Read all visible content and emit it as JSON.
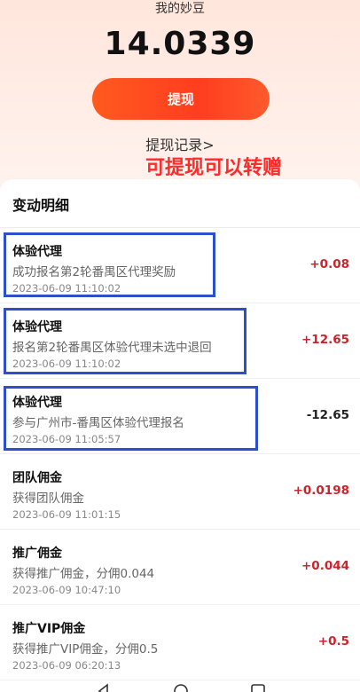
{
  "balance": {
    "label": "我的妙豆",
    "value": "14.0339"
  },
  "withdraw_button": "提现",
  "records_link": "提现记录>",
  "annotation": "可提现可以转赠",
  "details": {
    "title": "变动明细",
    "rows": [
      {
        "title": "体验代理",
        "desc": "成功报名第2轮番禺区代理奖励",
        "time": "2023-06-09 11:10:02",
        "amount": "+0.08"
      },
      {
        "title": "体验代理",
        "desc": "报名第2轮番禺区体验代理未选中退回",
        "time": "2023-06-09 11:10:02",
        "amount": "+12.65"
      },
      {
        "title": "体验代理",
        "desc": "参与广州市-番禺区体验代理报名",
        "time": "2023-06-09 11:05:57",
        "amount": "-12.65"
      },
      {
        "title": "团队佣金",
        "desc": "获得团队佣金",
        "time": "2023-06-09 11:01:15",
        "amount": "+0.0198"
      },
      {
        "title": "推广佣金",
        "desc": "获得推广佣金，分佣0.044",
        "time": "2023-06-09 10:47:10",
        "amount": "+0.044"
      },
      {
        "title": "推广VIP佣金",
        "desc": "获得推广VIP佣金，分佣0.5",
        "time": "2023-06-09 06:20:13",
        "amount": "+0.5"
      }
    ]
  },
  "colors": {
    "accent": "#ff4a1f",
    "positive": "#c9252d",
    "annotation": "#ff2a2a",
    "highlight_box": "#2d4fcc"
  },
  "navbar_icons": [
    "back-icon",
    "home-icon",
    "recents-icon"
  ]
}
